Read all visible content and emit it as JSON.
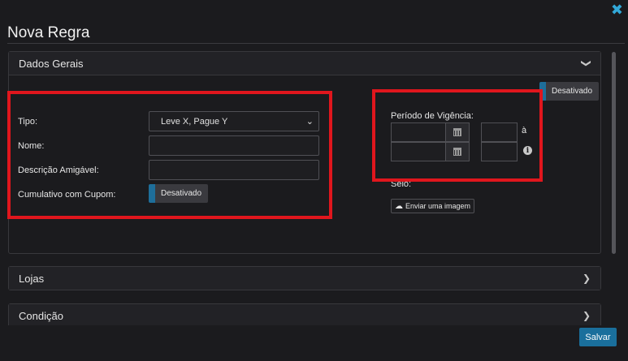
{
  "modal": {
    "title": "Nova Regra",
    "close_icon": "close-icon"
  },
  "panels": {
    "general": {
      "title": "Dados Gerais",
      "expanded": true,
      "form": {
        "tipo_label": "Tipo:",
        "tipo_value": "Leve X, Pague Y",
        "nome_label": "Nome:",
        "nome_value": "",
        "descricao_label": "Descrição Amigável:",
        "descricao_value": "",
        "cumulativo_label": "Cumulativo com Cupom:",
        "cumulativo_toggle": "Desativado"
      },
      "status_toggle": "Desativado",
      "periodo_label": "Período de Vigência:",
      "periodo_separator": "à",
      "selo_label": "Selo:",
      "upload_label": "Enviar uma imagem"
    },
    "lojas": {
      "title": "Lojas"
    },
    "condicao": {
      "title": "Condição"
    }
  },
  "footer": {
    "save_label": "Salvar"
  },
  "colors": {
    "accent": "#1a6f9c",
    "close": "#32a8d8",
    "highlight": "#e0161d",
    "background": "#1b1b1e"
  }
}
